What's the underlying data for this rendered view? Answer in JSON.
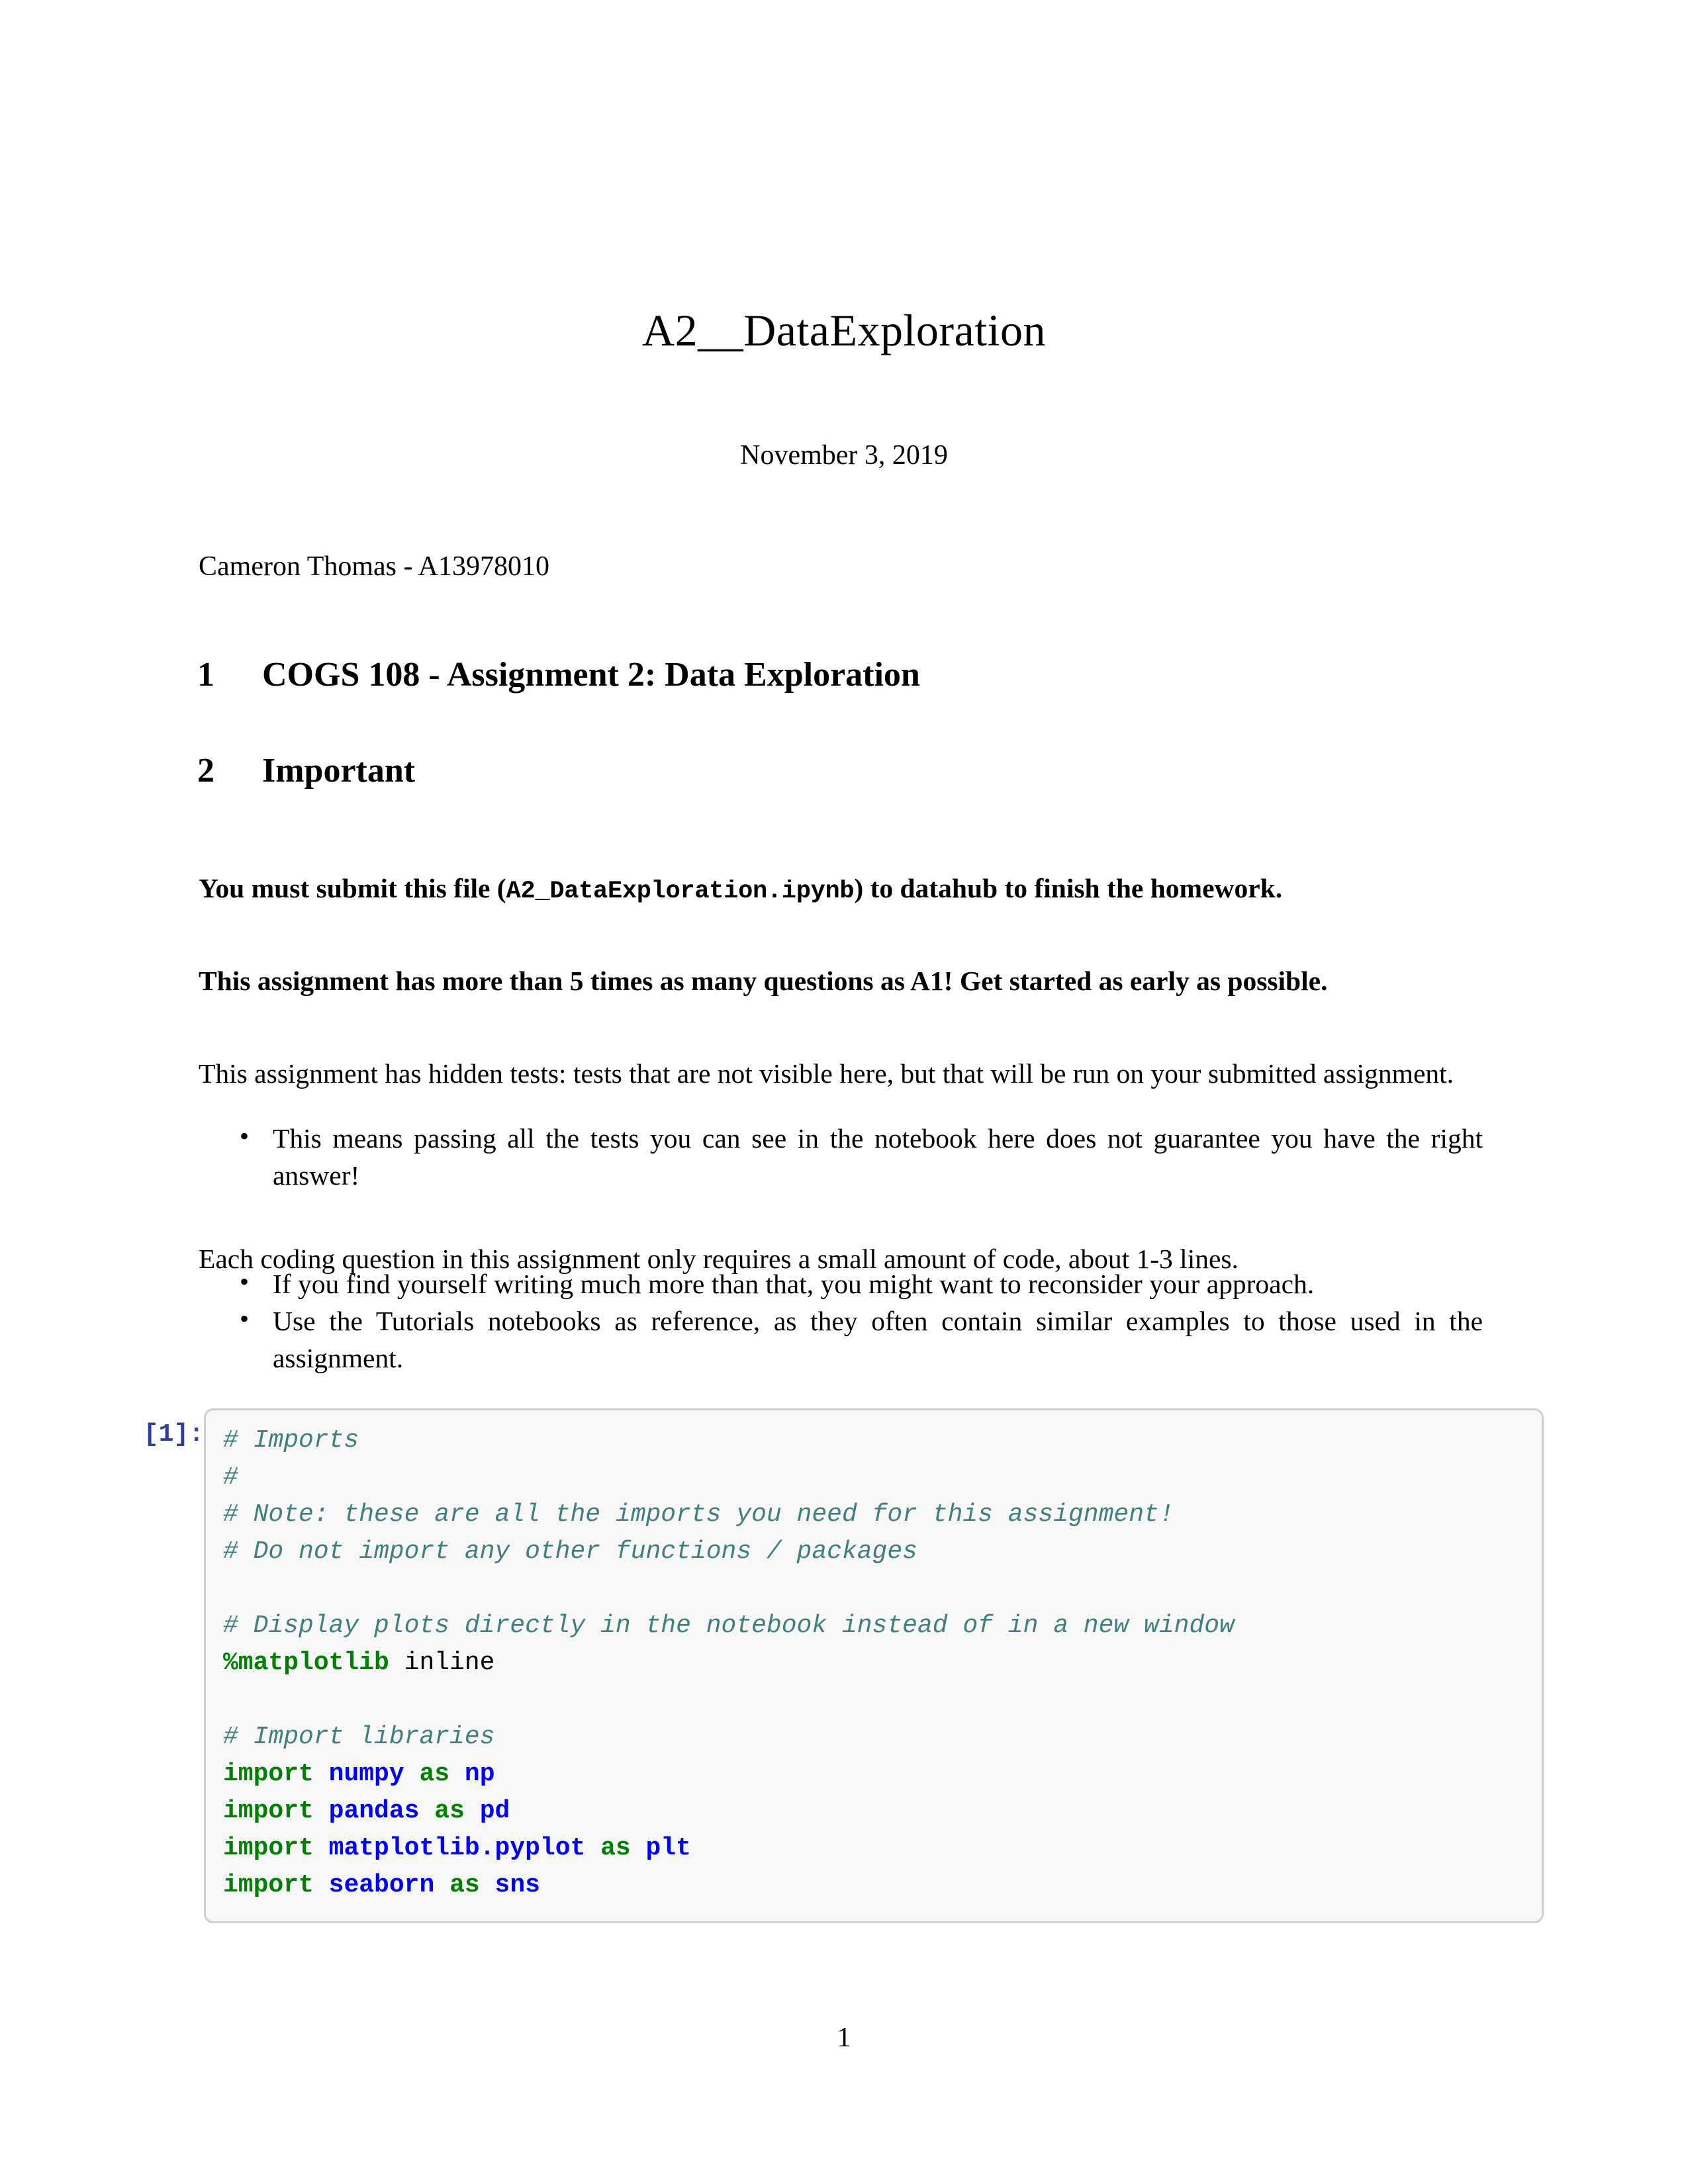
{
  "document": {
    "title": "A2__DataExploration",
    "date": "November 3, 2019",
    "author": "Cameron Thomas - A13978010",
    "page_number": "1"
  },
  "headings": [
    {
      "number": "1",
      "text": "COGS 108 - Assignment 2: Data Exploration"
    },
    {
      "number": "2",
      "text": "Important"
    }
  ],
  "paragraphs": {
    "submit": {
      "before_code": "You must submit this file (",
      "code": "A2_DataExploration.ipynb",
      "after_code": ") to datahub to finish the homework."
    },
    "times": "This assignment has more than 5 times as many questions as A1! Get started as early as possible.",
    "hidden": "This assignment has hidden tests: tests that are not visible here, but that will be run on your submitted assignment.",
    "each_coding": "Each coding question in this assignment only requires a small amount of code, about 1-3 lines."
  },
  "bullet_lists": {
    "first": [
      "This means passing all the tests you can see in the notebook here does not guarantee you have the right answer!"
    ],
    "second": [
      "If you find yourself writing much more than that, you might want to reconsider your approach.",
      "Use the Tutorials notebooks as reference, as they often contain similar examples to those used in the assignment."
    ]
  },
  "code_cell": {
    "prompt": "[1]:",
    "lines": [
      [
        {
          "t": "# Imports",
          "c": "cm"
        }
      ],
      [
        {
          "t": "#",
          "c": "cm"
        }
      ],
      [
        {
          "t": "# Note: these are all the imports you need for this assignment!",
          "c": "cm"
        }
      ],
      [
        {
          "t": "# Do not import any other functions / packages",
          "c": "cm"
        }
      ],
      [
        {
          "t": "",
          "c": "pl"
        }
      ],
      [
        {
          "t": "# Display plots directly in the notebook instead of in a new window",
          "c": "cm"
        }
      ],
      [
        {
          "t": "%matplotlib",
          "c": "mg"
        },
        {
          "t": " inline",
          "c": "pl"
        }
      ],
      [
        {
          "t": "",
          "c": "pl"
        }
      ],
      [
        {
          "t": "# Import libraries",
          "c": "cm"
        }
      ],
      [
        {
          "t": "import",
          "c": "kw"
        },
        {
          "t": " ",
          "c": "pl"
        },
        {
          "t": "numpy",
          "c": "nn"
        },
        {
          "t": " ",
          "c": "pl"
        },
        {
          "t": "as",
          "c": "kw"
        },
        {
          "t": " ",
          "c": "pl"
        },
        {
          "t": "np",
          "c": "nn"
        }
      ],
      [
        {
          "t": "import",
          "c": "kw"
        },
        {
          "t": " ",
          "c": "pl"
        },
        {
          "t": "pandas",
          "c": "nn"
        },
        {
          "t": " ",
          "c": "pl"
        },
        {
          "t": "as",
          "c": "kw"
        },
        {
          "t": " ",
          "c": "pl"
        },
        {
          "t": "pd",
          "c": "nn"
        }
      ],
      [
        {
          "t": "import",
          "c": "kw"
        },
        {
          "t": " ",
          "c": "pl"
        },
        {
          "t": "matplotlib.pyplot",
          "c": "nn"
        },
        {
          "t": " ",
          "c": "pl"
        },
        {
          "t": "as",
          "c": "kw"
        },
        {
          "t": " ",
          "c": "pl"
        },
        {
          "t": "plt",
          "c": "nn"
        }
      ],
      [
        {
          "t": "import",
          "c": "kw"
        },
        {
          "t": " ",
          "c": "pl"
        },
        {
          "t": "seaborn",
          "c": "nn"
        },
        {
          "t": " ",
          "c": "pl"
        },
        {
          "t": "as",
          "c": "kw"
        },
        {
          "t": " ",
          "c": "pl"
        },
        {
          "t": "sns",
          "c": "nn"
        }
      ]
    ]
  },
  "colors": {
    "comment": "#3f7f7f",
    "keyword": "#008000",
    "module": "#0000ff",
    "prompt": "#303f9f",
    "cell_background": "#f7f7f7",
    "cell_border": "#cfcfcf"
  }
}
